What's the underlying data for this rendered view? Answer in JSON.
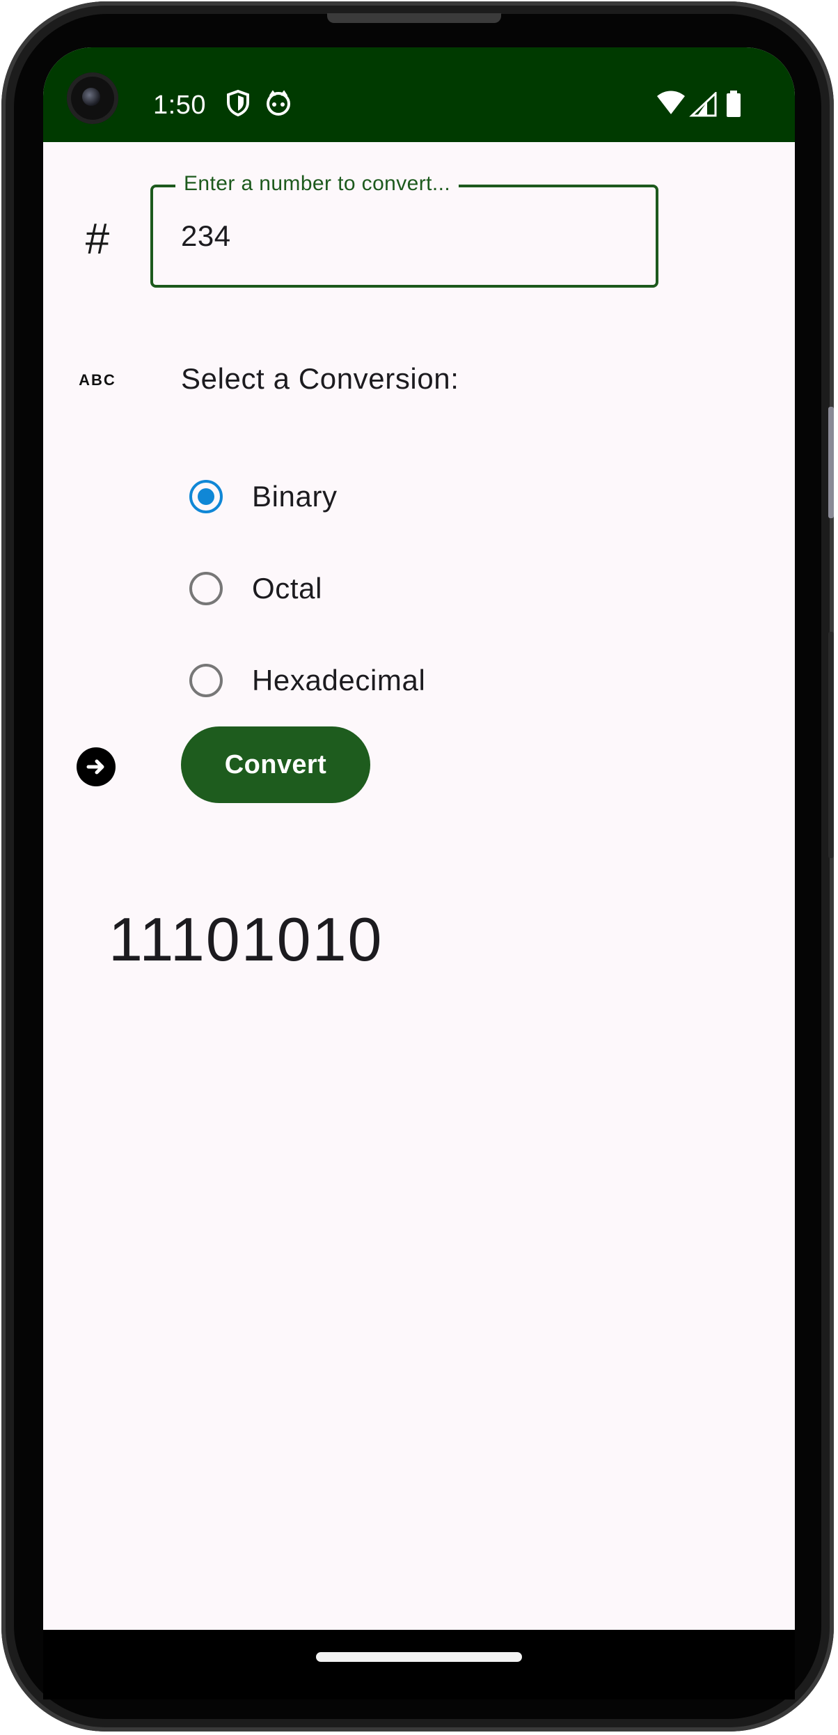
{
  "status_bar": {
    "time": "1:50"
  },
  "input": {
    "label": "Enter a number to convert...",
    "value": "234"
  },
  "conversion": {
    "title": "Select a Conversion:",
    "options": [
      {
        "label": "Binary",
        "selected": true
      },
      {
        "label": "Octal",
        "selected": false
      },
      {
        "label": "Hexadecimal",
        "selected": false
      }
    ]
  },
  "convert_button": {
    "label": "Convert"
  },
  "result": {
    "value": "11101010"
  },
  "icons": {
    "number": "#",
    "text": "ABC"
  },
  "colors": {
    "status_bar": "#003a00",
    "primary_green": "#1e5c1e",
    "radio_selected": "#1087d6",
    "background": "#fdf8fb"
  }
}
